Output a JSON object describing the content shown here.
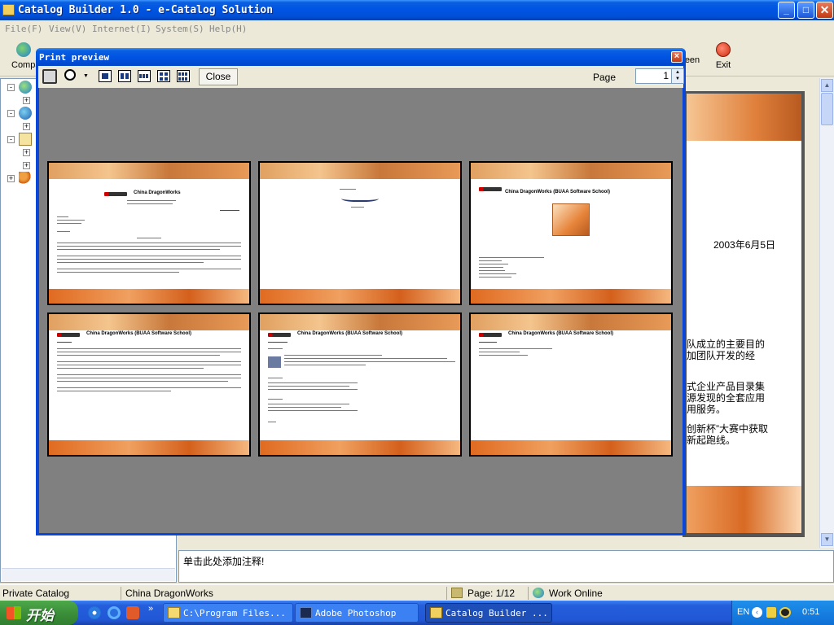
{
  "app": {
    "title": "Catalog Builder 1.0 - e-Catalog Solution",
    "minimize": "_",
    "maximize": "□",
    "close": "✕"
  },
  "menu": [
    "File(F)",
    "View(V)",
    "Internet(I)",
    "System(S)",
    "Help(H)"
  ],
  "toolbar": {
    "left_label": "Compa",
    "screen_label": "een",
    "exit_label": "Exit"
  },
  "document": {
    "date": "2003年6月5日",
    "para1": [
      "队成立的主要目的",
      "加团队开发的经"
    ],
    "para2": [
      "式企业产品目录集",
      "源发现的全套应用",
      "用服务。"
    ],
    "para3": [
      "创新杯”大赛中获取",
      "新起跑线。"
    ]
  },
  "note": "单击此处添加注释!",
  "status": {
    "catalog": "Private Catalog",
    "company": "China DragonWorks",
    "page": "Page: 1/12",
    "online": "Work Online"
  },
  "taskbar": {
    "start": "开始",
    "tasks": [
      "C:\\Program Files...",
      "Adobe Photoshop",
      "Catalog Builder ..."
    ],
    "lang": "EN",
    "clock": "0:51"
  },
  "preview": {
    "title": "Print preview",
    "close_button": "Close",
    "page_label": "Page",
    "page_value": "1",
    "pages": [
      {
        "header": "China DragonWorks"
      },
      {
        "header": ""
      },
      {
        "header": "China DragonWorks (BUAA Software School)"
      },
      {
        "header": "China DragonWorks (BUAA Software School)"
      },
      {
        "header": "China DragonWorks (BUAA Software School)"
      },
      {
        "header": "China DragonWorks (BUAA Software School)"
      }
    ]
  },
  "colors": {
    "titlebar": "#0054e3",
    "preview_bg": "#808080",
    "page_band": "#e0803c",
    "taskbar": "#245edb",
    "start_green": "#3c8f3a"
  }
}
